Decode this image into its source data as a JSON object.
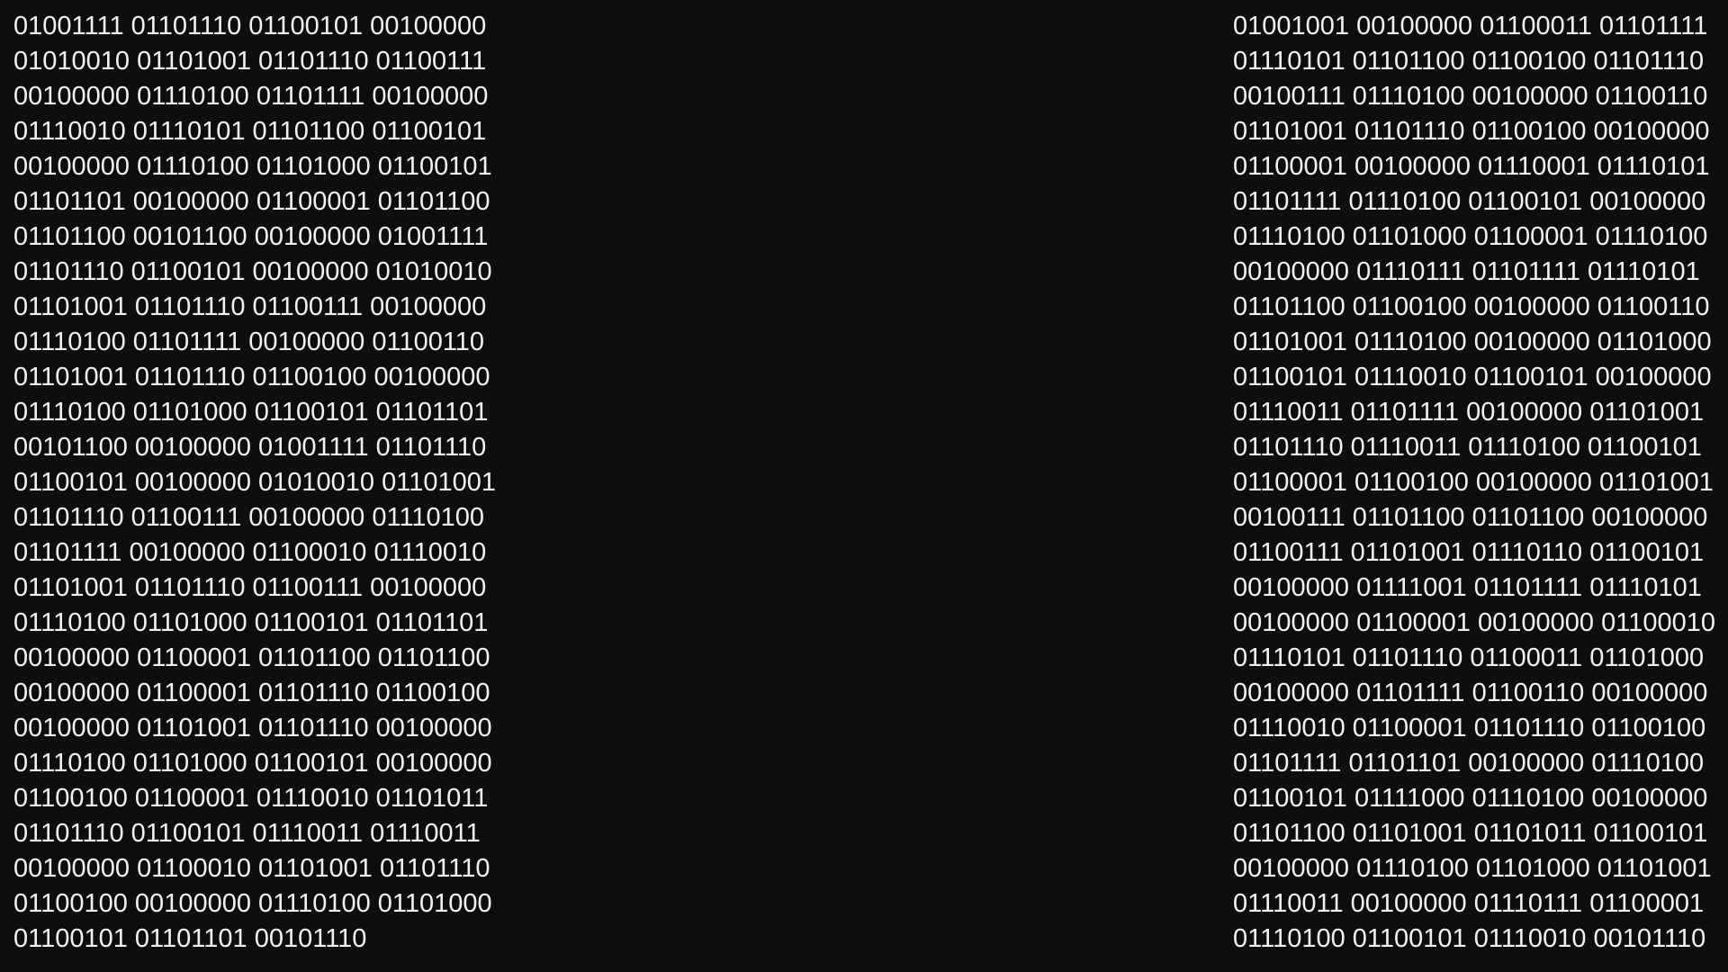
{
  "left_column": [
    "01001111 01101110 01100101 00100000",
    "01010010 01101001 01101110 01100111",
    "00100000 01110100 01101111 00100000",
    "01110010 01110101 01101100 01100101",
    "00100000 01110100 01101000 01100101",
    "01101101 00100000 01100001 01101100",
    "01101100 00101100 00100000 01001111",
    "01101110 01100101 00100000 01010010",
    "01101001 01101110 01100111 00100000",
    "01110100 01101111 00100000 01100110",
    "01101001 01101110 01100100 00100000",
    "01110100 01101000 01100101 01101101",
    "00101100 00100000 01001111 01101110",
    "01100101 00100000 01010010 01101001",
    "01101110 01100111 00100000 01110100",
    "01101111 00100000 01100010 01110010",
    "01101001 01101110 01100111 00100000",
    "01110100 01101000 01100101 01101101",
    "00100000 01100001 01101100 01101100",
    "00100000 01100001 01101110 01100100",
    "00100000 01101001 01101110 00100000",
    "01110100 01101000 01100101 00100000",
    "01100100 01100001 01110010 01101011",
    "01101110 01100101 01110011 01110011",
    "00100000 01100010 01101001 01101110",
    "01100100 00100000 01110100 01101000",
    "01100101 01101101 00101110"
  ],
  "right_column": [
    "01001001 00100000 01100011 01101111",
    "01110101 01101100 01100100 01101110",
    "00100111 01110100 00100000 01100110",
    "01101001 01101110 01100100 00100000",
    "01100001 00100000 01110001 01110101",
    "01101111 01110100 01100101 00100000",
    "01110100 01101000 01100001 01110100",
    "00100000 01110111 01101111 01110101",
    "01101100 01100100 00100000 01100110",
    "01101001 01110100 00100000 01101000",
    "01100101 01110010 01100101 00100000",
    "01110011 01101111 00100000 01101001",
    "01101110 01110011 01110100 01100101",
    "01100001 01100100 00100000 01101001",
    "00100111 01101100 01101100 00100000",
    "01100111 01101001 01110110 01100101",
    "00100000 01111001 01101111 01110101",
    "00100000 01100001 00100000 01100010",
    "01110101 01101110 01100011 01101000",
    "00100000 01101111 01100110 00100000",
    "01110010 01100001 01101110 01100100",
    "01101111 01101101 00100000 01110100",
    "01100101 01111000 01110100 00100000",
    "01101100 01101001 01101011 01100101",
    "00100000 01110100 01101000 01101001",
    "01110011 00100000 01110111 01100001",
    "01110100 01100101 01110010 00101110"
  ]
}
